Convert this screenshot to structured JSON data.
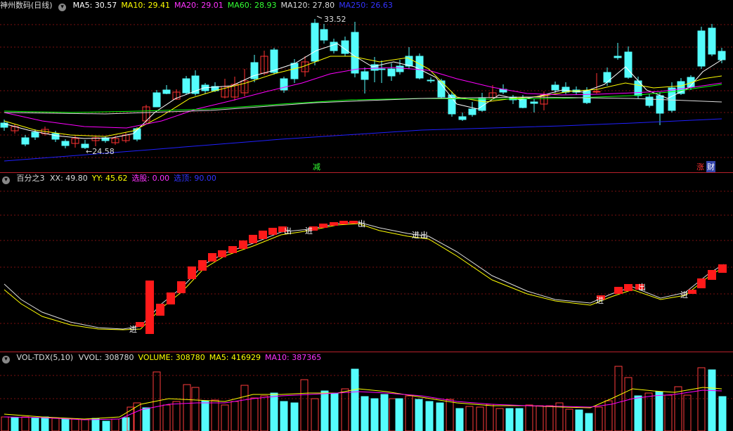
{
  "colors": {
    "up": "#ff3232",
    "down": "#54fcfc",
    "ma5": "#ffffff",
    "ma10": "#ffff00",
    "ma20": "#ff00ff",
    "ma60": "#00ff00",
    "ma120": "#dddddd",
    "ma250": "#2020ff",
    "grid": "#7a1010",
    "sep": "#b8202a"
  },
  "main": {
    "title": "神州数码(日线)",
    "indicators": [
      {
        "label": "MA5: 30.57",
        "color": "#ffffff"
      },
      {
        "label": "MA10: 29.41",
        "color": "#ffff00"
      },
      {
        "label": "MA20: 29.01",
        "color": "#ff33ff"
      },
      {
        "label": "MA60: 28.93",
        "color": "#33ff33"
      },
      {
        "label": "MA120: 27.80",
        "color": "#dddddd"
      },
      {
        "label": "MA250: 26.63",
        "color": "#3333ff"
      }
    ],
    "high_label": "33.52",
    "low_label": "24.58",
    "mark_reduce": "减",
    "mark_up": "涨",
    "mark_fin": "财"
  },
  "ind": {
    "title": "百分之3",
    "items": [
      {
        "label": "XX: 49.80",
        "color": "#dddddd"
      },
      {
        "label": "YY: 45.62",
        "color": "#ffff00"
      },
      {
        "label": "选股: 0.00",
        "color": "#ff33ff"
      },
      {
        "label": "选顶: 90.00",
        "color": "#3333ff"
      }
    ],
    "enter": "进",
    "exit": "出"
  },
  "vol": {
    "title": "VOL-TDX(5,10)",
    "items": [
      {
        "label": "VVOL: 308780",
        "color": "#dddddd"
      },
      {
        "label": "VOLUME: 308780",
        "color": "#ffff00"
      },
      {
        "label": "MA5: 416929",
        "color": "#ffff00"
      },
      {
        "label": "MA10: 387365",
        "color": "#ff33ff"
      }
    ]
  }
}
